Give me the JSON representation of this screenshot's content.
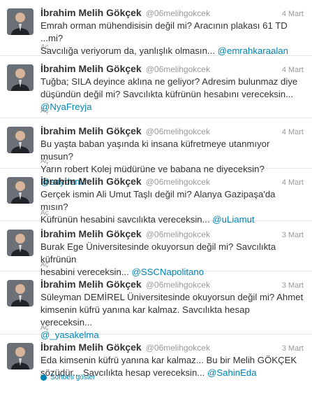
{
  "tweets": [
    {
      "name": "İbrahim Melih Gökçek",
      "handle": "@06melihgokcek",
      "time": "4 Mart",
      "text": "Emrah orman mühendisisin değil mi? Aracının plakası 61 TD ...mi?\nSavcılığa veriyorum da, yanlışlık olmasın... ",
      "mention": "@emrahkaraalan",
      "expand": "Aç"
    },
    {
      "name": "İbrahim Melih Gökçek",
      "handle": "@06melihgokcek",
      "time": "4 Mart",
      "text": "Tuğba; SILA deyince aklına ne geliyor? Adresim bulunmaz diye\ndüşündün değil mi? Savcılıkta küfrünün hesabını vereceksin...\n",
      "mention": "@NyaFreyja",
      "expand": "Aç"
    },
    {
      "name": "İbrahim Melih Gökçek",
      "handle": "@06melihgokcek",
      "time": "4 Mart",
      "text": "Bu yaşta baban yaşında ki insana küfretmeye utanmıyor musun?\nYarın robert Kolej müdürüne ve babana ne diyeceksin? ",
      "mention": "@eaydemir",
      "expand": "Aç"
    },
    {
      "name": "İbrahim Melih Gökçek",
      "handle": "@06melihgokcek",
      "time": "4 Mart",
      "text": "Gerçek ismin Ali Umut Taşlı değil mi? Alanya Gazipaşa'da mısın?\nKüfrünün hesabini savcılıkta vereceksin... ",
      "mention": "@uLiamut",
      "expand": "Aç"
    },
    {
      "name": "İbrahim Melih Gökçek",
      "handle": "@06melihgokcek",
      "time": "3 Mart",
      "text": "Burak Ege Üniversitesinde okuyorsun değil mi? Savcılıkta küfrünün\nhesabini vereceksin... ",
      "mention": "@SSCNapolitano",
      "expand": "Aç"
    },
    {
      "name": "İbrahim Melih Gökçek",
      "handle": "@06melihgokcek",
      "time": "3 Mart",
      "text": "Süleyman DEMİREL Üniversitesinde okuyorsun değil mi? Ahmet\nkimsenin küfrü yanına kar kalmaz. Savcılıkta hesap vereceksin...\n",
      "mention": "@_yasakelma",
      "expand": "Aç"
    },
    {
      "name": "İbrahim Melih Gökçek",
      "handle": "@06melihgokcek",
      "time": "3 Mart",
      "text": "Eda kimsenin küfrü yanına kar kalmaz... Bu bir Melih GÖKÇEK\nsözüdür... Savcılıkta hesap vereceksin... ",
      "mention": "@SahinEda",
      "conversation": "Sohbeti göster"
    }
  ],
  "colors": {
    "link": "#0084b4",
    "text": "#333333",
    "muted": "#999999",
    "divider": "#e8e8e8"
  }
}
